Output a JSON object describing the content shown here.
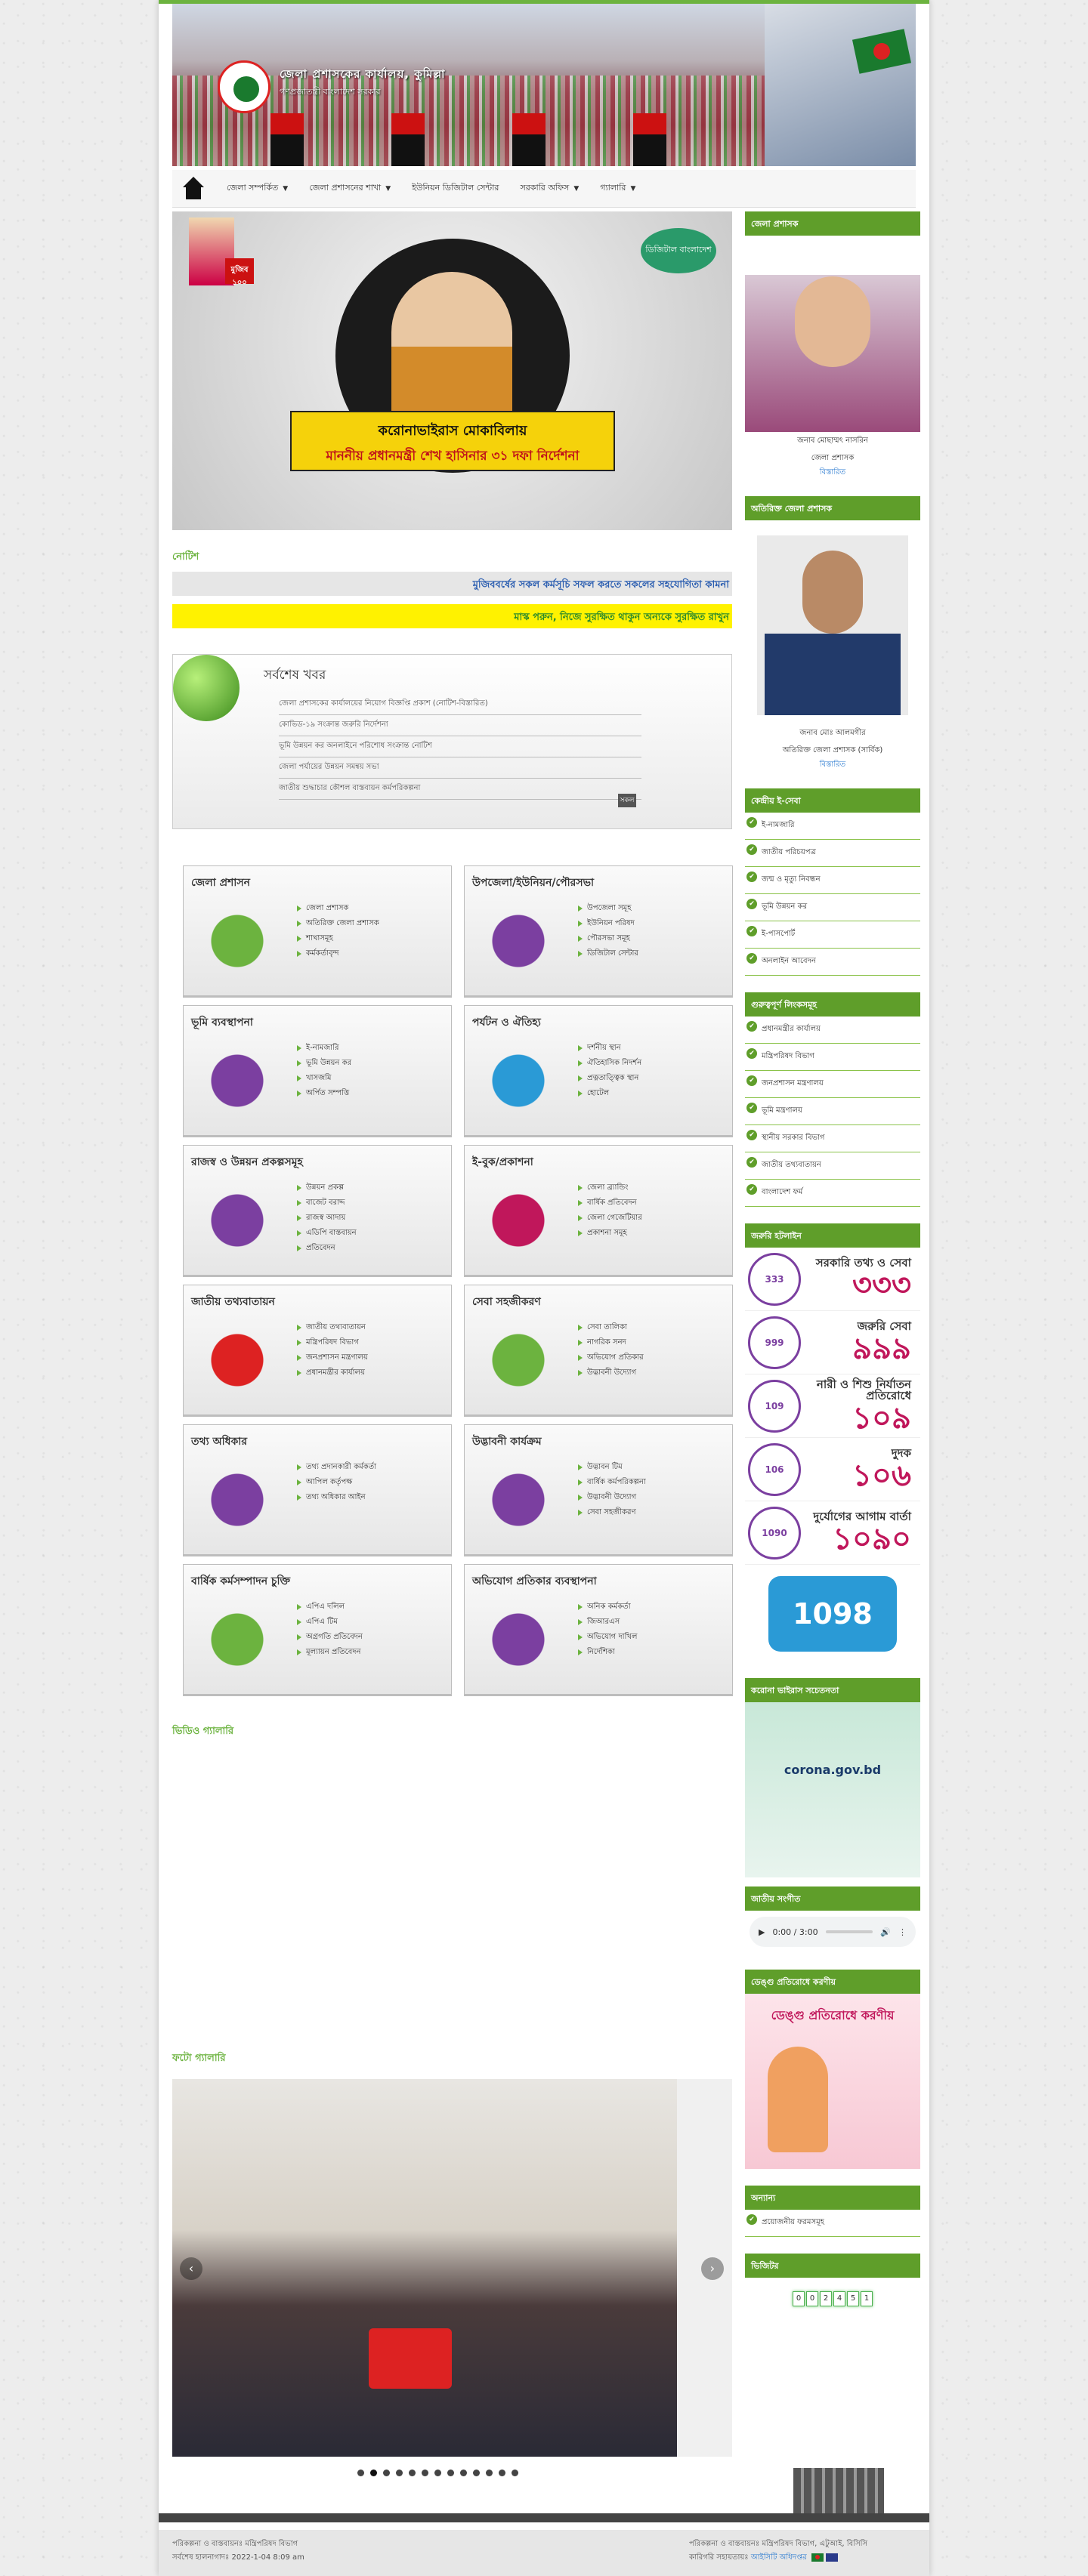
{
  "header": {
    "site_title": "জেলা প্রশাসকের কার্যালয়, কুমিল্লা",
    "site_sub": "গণপ্রজাতন্ত্রী বাংলাদেশ সরকার"
  },
  "nav": {
    "items": [
      {
        "label": "জেলা সম্পর্কিত",
        "dropdown": true
      },
      {
        "label": "জেলা প্রশাসনের শাখা",
        "dropdown": true
      },
      {
        "label": "ইউনিয়ন ডিজিটাল সেন্টার",
        "dropdown": false
      },
      {
        "label": "সরকারি অফিস",
        "dropdown": true
      },
      {
        "label": "গ্যালারি",
        "dropdown": true
      }
    ]
  },
  "hero": {
    "caption_line1": "করোনাভাইরাস মোকাবিলায়",
    "caption_line2": "মাননীয় প্রধানমন্ত্রী শেখ হাসিনার ৩১ দফা নির্দেশনা",
    "mujib_badge": "মুজিব ১০০",
    "logo2": "ডিজিটাল বাংলাদেশ"
  },
  "notice": {
    "title": "নোটিশ",
    "marquee1": "মুজিববর্ষের সকল কর্মসূচি সফল করতে সকলের সহযোগিতা কামনা",
    "marquee2": "মাস্ক পরুন, নিজে সুরক্ষিত থাকুন অন্যকে সুরক্ষিত রাখুন"
  },
  "news": {
    "title": "সর্বশেষ খবর",
    "items": [
      "জেলা প্রশাসকের কার্যালয়ের নিয়োগ বিজ্ঞপ্তি প্রকাশ (নোটিশ-বিস্তারিত)",
      "কোভিড-১৯ সংক্রান্ত জরুরি নির্দেশনা",
      "ভূমি উন্নয়ন কর অনলাইনে পরিশোধ সংক্রান্ত নোটিশ",
      "জেলা পর্যায়ের উন্নয়ন সমন্বয় সভা",
      "জাতীয় শুদ্ধাচার কৌশল বাস্তবায়ন কর্মপরিকল্পনা"
    ],
    "all_label": "সকল"
  },
  "boxes": [
    {
      "title": "জেলা প্রশাসন",
      "items": [
        "জেলা প্রশাসক",
        "অতিরিক্ত জেলা প্রশাসক",
        "শাখাসমূহ",
        "কর্মকর্তাবৃন্দ"
      ]
    },
    {
      "title": "উপজেলা/ইউনিয়ন/পৌরসভা",
      "items": [
        "উপজেলা সমূহ",
        "ইউনিয়ন পরিষদ",
        "পৌরসভা সমূহ",
        "ডিজিটাল সেন্টার"
      ]
    },
    {
      "title": "ভূমি ব্যবস্থাপনা",
      "items": [
        "ই-নামজারি",
        "ভূমি উন্নয়ন কর",
        "খাসজমি",
        "অর্পিত সম্পত্তি"
      ]
    },
    {
      "title": "পর্যটন ও ঐতিহ্য",
      "items": [
        "দর্শনীয় স্থান",
        "ঐতিহাসিক নিদর্শন",
        "প্রত্নতাত্ত্বিক স্থান",
        "হোটেল"
      ]
    },
    {
      "title": "রাজস্ব ও উন্নয়ন প্রকল্পসমূহ",
      "items": [
        "উন্নয়ন প্রকল্প",
        "বাজেট বরাদ্দ",
        "রাজস্ব আদায়",
        "এডিপি বাস্তবায়ন",
        "প্রতিবেদন"
      ]
    },
    {
      "title": "ই-বুক/প্রকাশনা",
      "items": [
        "জেলা ব্র্যান্ডিং",
        "বার্ষিক প্রতিবেদন",
        "জেলা গেজেটিয়ার",
        "প্রকাশনা সমূহ"
      ]
    },
    {
      "title": "জাতীয় তথ্যবাতায়ন",
      "items": [
        "জাতীয় তথ্যবাতায়ন",
        "মন্ত্রিপরিষদ বিভাগ",
        "জনপ্রশাসন মন্ত্রণালয়",
        "প্রধানমন্ত্রীর কার্যালয়"
      ]
    },
    {
      "title": "সেবা সহজীকরণ",
      "items": [
        "সেবা তালিকা",
        "নাগরিক সনদ",
        "অভিযোগ প্রতিকার",
        "উদ্ভাবনী উদ্যোগ"
      ]
    },
    {
      "title": "তথ্য অধিকার",
      "items": [
        "তথ্য প্রদানকারী কর্মকর্তা",
        "আপিল কর্তৃপক্ষ",
        "তথ্য অধিকার আইন"
      ]
    },
    {
      "title": "উদ্ভাবনী কার্যক্রম",
      "items": [
        "উদ্ভাবন টিম",
        "বার্ষিক কর্মপরিকল্পনা",
        "উদ্ভাবনী উদ্যোগ",
        "সেবা সহজীকরণ"
      ]
    },
    {
      "title": "বার্ষিক কর্মসম্পাদন চুক্তি",
      "items": [
        "এপিএ দলিল",
        "এপিএ টিম",
        "অগ্রগতি প্রতিবেদন",
        "মূল্যায়ন প্রতিবেদন"
      ]
    },
    {
      "title": "অভিযোগ প্রতিকার ব্যবস্থাপনা",
      "items": [
        "অনিক কর্মকর্তা",
        "জিআরএস",
        "অভিযোগ দাখিল",
        "নির্দেশিকা"
      ]
    }
  ],
  "video": {
    "title": "ভিডিও গ্যালারি"
  },
  "photo": {
    "title": "ফটো গ্যালারি"
  },
  "sidebar": {
    "officer1": {
      "heading": "জেলা প্রশাসক",
      "name": "জনাব মোছাম্মৎ নাসরিন",
      "designation": "জেলা প্রশাসক",
      "link": "বিস্তারিত"
    },
    "officer2": {
      "heading": "অতিরিক্ত জেলা প্রশাসক",
      "name": "জনাব মোঃ আলমগীর",
      "designation": "অতিরিক্ত জেলা প্রশাসক (সার্বিক)",
      "link": "বিস্তারিত"
    },
    "eservice": {
      "heading": "কেন্দ্রীয় ই-সেবা",
      "items": [
        "ই-নামজারি",
        "জাতীয় পরিচয়পত্র",
        "জন্ম ও মৃত্যু নিবন্ধন",
        "ভূমি উন্নয়ন কর",
        "ই-পাসপোর্ট",
        "অনলাইন আবেদন"
      ]
    },
    "links": {
      "heading": "গুরুত্বপূর্ণ লিংকসমূহ",
      "items": [
        "প্রধানমন্ত্রীর কার্যালয়",
        "মন্ত্রিপরিষদ বিভাগ",
        "জনপ্রশাসন মন্ত্রণালয়",
        "ভূমি মন্ত্রণালয়",
        "স্থানীয় সরকার বিভাগ",
        "জাতীয় তথ্যবাতায়ন",
        "বাংলাদেশ ফর্ম"
      ]
    },
    "hotlines": {
      "heading": "জরুরি হটলাইন",
      "items": [
        {
          "code": "333",
          "label": "সরকারি তথ্য ও সেবা",
          "number": "৩৩৩"
        },
        {
          "code": "999",
          "label": "জরুরি সেবা",
          "number": "৯৯৯"
        },
        {
          "code": "109",
          "label": "নারী ও শিশু নির্যাতন প্রতিরোধে",
          "number": "১০৯"
        },
        {
          "code": "106",
          "label": "দুদক",
          "number": "১০৬"
        },
        {
          "code": "1090",
          "label": "দুর্যোগের আগাম বার্তা",
          "number": "১০৯০"
        }
      ],
      "helpline": "1098"
    },
    "covid": {
      "heading": "করোনা ভাইরাস সচেতনতা",
      "text": "corona.gov.bd"
    },
    "anthem": {
      "heading": "জাতীয় সংগীত",
      "time": "0:00 / 3:00"
    },
    "dengue": {
      "heading": "ডেঙ্গু প্রতিরোধে করণীয়",
      "text": "ডেঙ্গু প্রতিরোধে করণীয়"
    },
    "other": {
      "heading": "অন্যান্য",
      "items": [
        "প্রয়োজনীয় ফরমসমূহ"
      ]
    },
    "visitors": {
      "heading": "ভিজিটর",
      "digits": [
        "0",
        "0",
        "2",
        "4",
        "5",
        "1"
      ]
    }
  },
  "footer": {
    "left1": "পরিকল্পনা ও বাস্তবায়নঃ মন্ত্রিপরিষদ বিভাগ",
    "left2": "সর্বশেষ হালনাগাদঃ 2022-1-04 8:09 am",
    "right1": "পরিকল্পনা ও বাস্তবায়নঃ মন্ত্রিপরিষদ বিভাগ, এটুআই, বিসিসি",
    "right2": "কারিগরি সহায়তায়ঃ",
    "right_link": "আইসিটি অধিদপ্তর"
  },
  "colors": {
    "brand": "#6cb33f",
    "sidebar_head": "#5f9e2a",
    "accent_hot": "#c0175b"
  }
}
